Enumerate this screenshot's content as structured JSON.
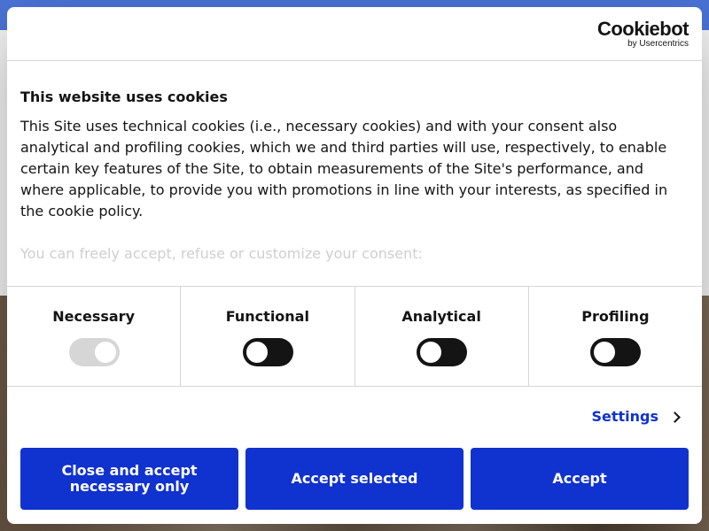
{
  "brand": {
    "name": "Cookiebot",
    "byline": "by Usercentrics"
  },
  "dialog": {
    "title": "This website uses cookies",
    "body": "This Site uses technical cookies (i.e., necessary cookies) and with your consent also analytical and profiling cookies, which we and third parties will use, respectively, to enable certain key features of the Site, to obtain measurements of the Site's performance, and where applicable, to provide you with promotions in line with your interests, as specified in the cookie policy.",
    "faded_text": "You can freely accept, refuse or customize your consent:"
  },
  "toggles": [
    {
      "label": "Necessary",
      "checked": true,
      "disabled": true
    },
    {
      "label": "Functional",
      "checked": false,
      "disabled": false
    },
    {
      "label": "Analytical",
      "checked": false,
      "disabled": false
    },
    {
      "label": "Profiling",
      "checked": false,
      "disabled": false
    }
  ],
  "settings_label": "Settings",
  "buttons": {
    "close_accept_necessary": "Close and accept necessary only",
    "accept_selected": "Accept selected",
    "accept": "Accept"
  },
  "colors": {
    "accent": "#1032cf",
    "toggle_on": "#141414",
    "toggle_disabled": "#d6d6d6",
    "background_header": "#4a73d6"
  }
}
